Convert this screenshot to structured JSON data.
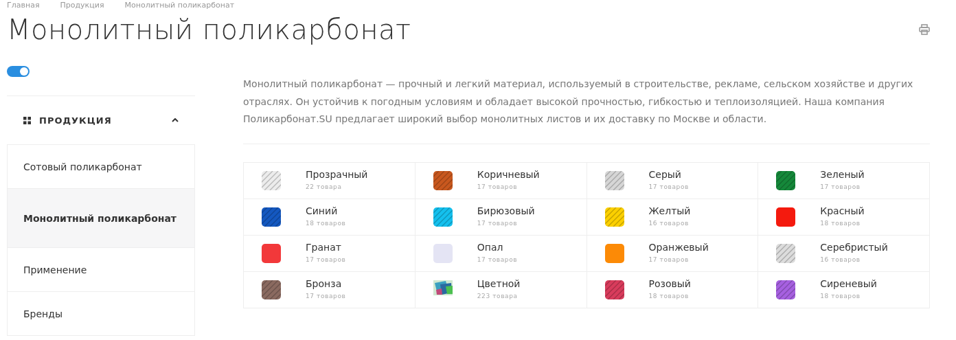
{
  "breadcrumbs": [
    "Главная",
    "Продукция",
    "Монолитный поликарбонат"
  ],
  "title": "Монолитный поликарбонат",
  "toggle": {
    "on": true
  },
  "sidebar": {
    "heading": "ПРОДУКЦИЯ",
    "expanded": true,
    "items": [
      {
        "label": "Сотовый поликарбонат",
        "selected": false
      },
      {
        "label": "Монолитный поликарбонат",
        "selected": true
      },
      {
        "label": "Применение",
        "selected": false
      },
      {
        "label": "Бренды",
        "selected": false
      }
    ]
  },
  "description": "Монолитный поликарбонат — прочный и легкий материал, используемый в строительстве, рекламе, сельском хозяйстве и других отраслях. Он устойчив к погодным условиям и обладает высокой прочностью, гибкостью и теплоизоляцией. Наша компания Поликарбонат.SU предлагает широкий выбор монолитных листов и их доставку по Москве и области.",
  "colors": [
    {
      "name": "Прозрачный",
      "count": "22 товара",
      "kind": "striped",
      "color": "#ececec"
    },
    {
      "name": "Коричневый",
      "count": "17 товаров",
      "kind": "striped",
      "color": "#c8581e"
    },
    {
      "name": "Серый",
      "count": "17 товаров",
      "kind": "striped",
      "color": "#d6d6d6"
    },
    {
      "name": "Зеленый",
      "count": "17 товаров",
      "kind": "striped",
      "color": "#15883a"
    },
    {
      "name": "Синий",
      "count": "18 товаров",
      "kind": "striped",
      "color": "#1458c0"
    },
    {
      "name": "Бирюзовый",
      "count": "17 товаров",
      "kind": "striped",
      "color": "#14c0ee"
    },
    {
      "name": "Желтый",
      "count": "16 товаров",
      "kind": "striped",
      "color": "#fcd000"
    },
    {
      "name": "Красный",
      "count": "18 товаров",
      "kind": "plain",
      "color": "#f41a0e"
    },
    {
      "name": "Гранат",
      "count": "17 товаров",
      "kind": "plain",
      "color": "#f2383a"
    },
    {
      "name": "Опал",
      "count": "17 товаров",
      "kind": "plain",
      "color": "#e4e4f4"
    },
    {
      "name": "Оранжевый",
      "count": "17 товаров",
      "kind": "plain",
      "color": "#fc8a06"
    },
    {
      "name": "Серебристый",
      "count": "16 товаров",
      "kind": "striped",
      "color": "#dcdcdc"
    },
    {
      "name": "Бронза",
      "count": "17 товаров",
      "kind": "striped",
      "color": "#8a6a60"
    },
    {
      "name": "Цветной",
      "count": "223 товара",
      "kind": "multi",
      "color": "#2a6aa0"
    },
    {
      "name": "Розовый",
      "count": "18 товаров",
      "kind": "striped",
      "color": "#d83c5c"
    },
    {
      "name": "Сиреневый",
      "count": "18 товаров",
      "kind": "striped",
      "color": "#a660e0"
    }
  ]
}
